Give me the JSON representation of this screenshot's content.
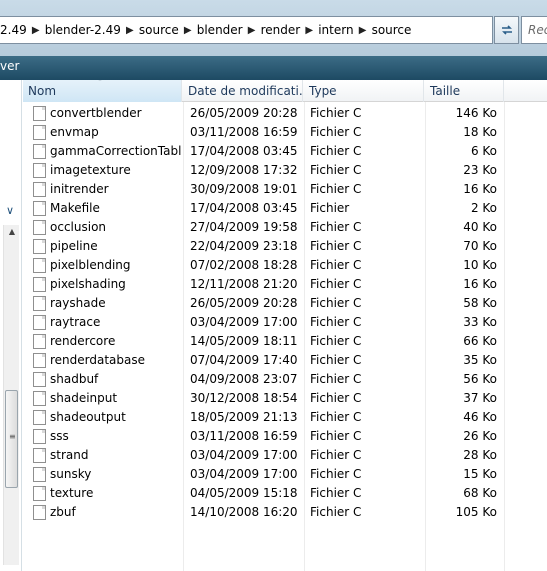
{
  "address": {
    "crumbs": [
      "2.49",
      "blender-2.49",
      "source",
      "blender",
      "render",
      "intern",
      "source"
    ],
    "refresh_icon": "refresh-icon",
    "search_placeholder": "Rech"
  },
  "toolbar": {
    "label": "ver"
  },
  "columns": {
    "name": "Nom",
    "date": "Date de modificati...",
    "type": "Type",
    "size": "Taille"
  },
  "files": [
    {
      "name": "convertblender",
      "date": "26/05/2009 20:28",
      "type": "Fichier C",
      "size": "146 Ko"
    },
    {
      "name": "envmap",
      "date": "03/11/2008 16:59",
      "type": "Fichier C",
      "size": "18 Ko"
    },
    {
      "name": "gammaCorrectionTabl...",
      "date": "17/04/2008 03:45",
      "type": "Fichier C",
      "size": "6 Ko"
    },
    {
      "name": "imagetexture",
      "date": "12/09/2008 17:32",
      "type": "Fichier C",
      "size": "23 Ko"
    },
    {
      "name": "initrender",
      "date": "30/09/2008 19:01",
      "type": "Fichier C",
      "size": "16 Ko"
    },
    {
      "name": "Makefile",
      "date": "17/04/2008 03:45",
      "type": "Fichier",
      "size": "2 Ko"
    },
    {
      "name": "occlusion",
      "date": "27/04/2009 19:58",
      "type": "Fichier C",
      "size": "40 Ko"
    },
    {
      "name": "pipeline",
      "date": "22/04/2009 23:18",
      "type": "Fichier C",
      "size": "70 Ko"
    },
    {
      "name": "pixelblending",
      "date": "07/02/2008 18:28",
      "type": "Fichier C",
      "size": "10 Ko"
    },
    {
      "name": "pixelshading",
      "date": "12/11/2008 21:20",
      "type": "Fichier C",
      "size": "16 Ko"
    },
    {
      "name": "rayshade",
      "date": "26/05/2009 20:28",
      "type": "Fichier C",
      "size": "58 Ko"
    },
    {
      "name": "raytrace",
      "date": "03/04/2009 17:00",
      "type": "Fichier C",
      "size": "33 Ko"
    },
    {
      "name": "rendercore",
      "date": "14/05/2009 18:11",
      "type": "Fichier C",
      "size": "66 Ko"
    },
    {
      "name": "renderdatabase",
      "date": "07/04/2009 17:40",
      "type": "Fichier C",
      "size": "35 Ko"
    },
    {
      "name": "shadbuf",
      "date": "04/09/2008 23:07",
      "type": "Fichier C",
      "size": "56 Ko"
    },
    {
      "name": "shadeinput",
      "date": "30/12/2008 18:54",
      "type": "Fichier C",
      "size": "37 Ko"
    },
    {
      "name": "shadeoutput",
      "date": "18/05/2009 21:13",
      "type": "Fichier C",
      "size": "46 Ko"
    },
    {
      "name": "sss",
      "date": "03/11/2008 16:59",
      "type": "Fichier C",
      "size": "26 Ko"
    },
    {
      "name": "strand",
      "date": "03/04/2009 17:00",
      "type": "Fichier C",
      "size": "28 Ko"
    },
    {
      "name": "sunsky",
      "date": "03/04/2009 17:00",
      "type": "Fichier C",
      "size": "15 Ko"
    },
    {
      "name": "texture",
      "date": "04/05/2009 15:18",
      "type": "Fichier C",
      "size": "68 Ko"
    },
    {
      "name": "zbuf",
      "date": "14/10/2008 16:20",
      "type": "Fichier C",
      "size": "105 Ko"
    }
  ]
}
